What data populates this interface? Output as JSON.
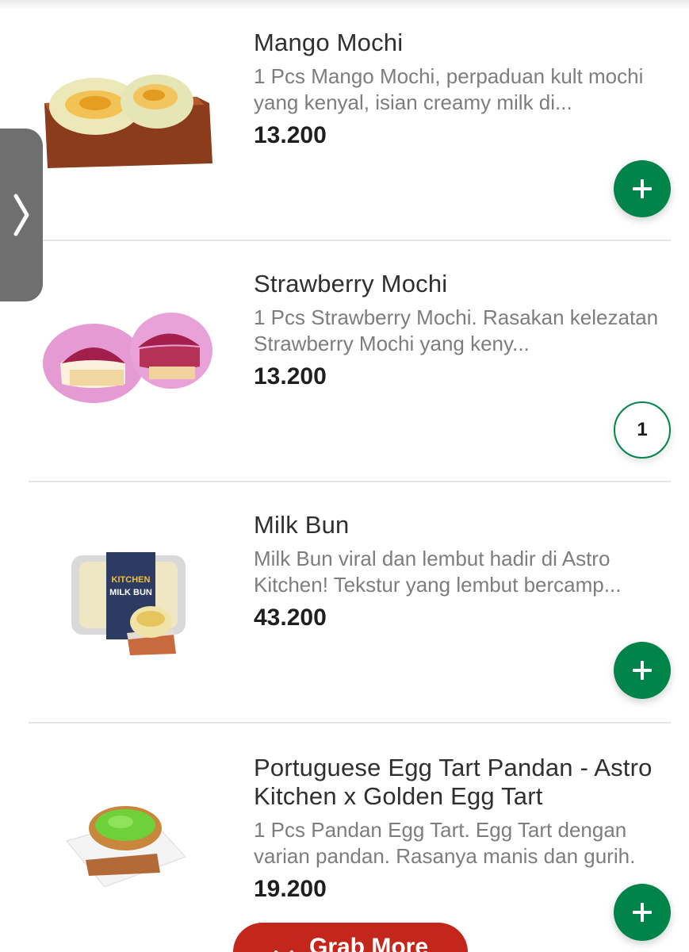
{
  "products": [
    {
      "name": "Mango Mochi",
      "description": "1 Pcs Mango Mochi, perpaduan kult mochi yang kenyal, isian creamy milk di...",
      "price": "13.200",
      "action": "add"
    },
    {
      "name": "Strawberry Mochi",
      "description": "1 Pcs Strawberry Mochi. Rasakan kelezatan Strawberry Mochi yang keny...",
      "price": "13.200",
      "action": "quantity",
      "quantity": "1"
    },
    {
      "name": "Milk Bun",
      "description": "Milk Bun viral dan lembut hadir di Astro Kitchen! Tekstur yang lembut bercamp...",
      "price": "43.200",
      "action": "add",
      "package_label_1": "KITCHEN",
      "package_label_2": "MILK BUN"
    },
    {
      "name": "Portuguese Egg Tart Pandan - Astro Kitchen x Golden Egg Tart",
      "description": "1 Pcs Pandan Egg Tart. Egg Tart dengan varian pandan. Rasanya manis dan gurih.",
      "price": "19.200",
      "action": "add"
    }
  ],
  "grab_more": {
    "label": "Grab More",
    "icon": "chevron-down-icon"
  },
  "side_tab": {
    "icon": "chevron-right-icon"
  },
  "colors": {
    "accent_green": "#00844a",
    "grab_red": "#c3271b",
    "side_tab_gray": "#6f6f6f"
  }
}
